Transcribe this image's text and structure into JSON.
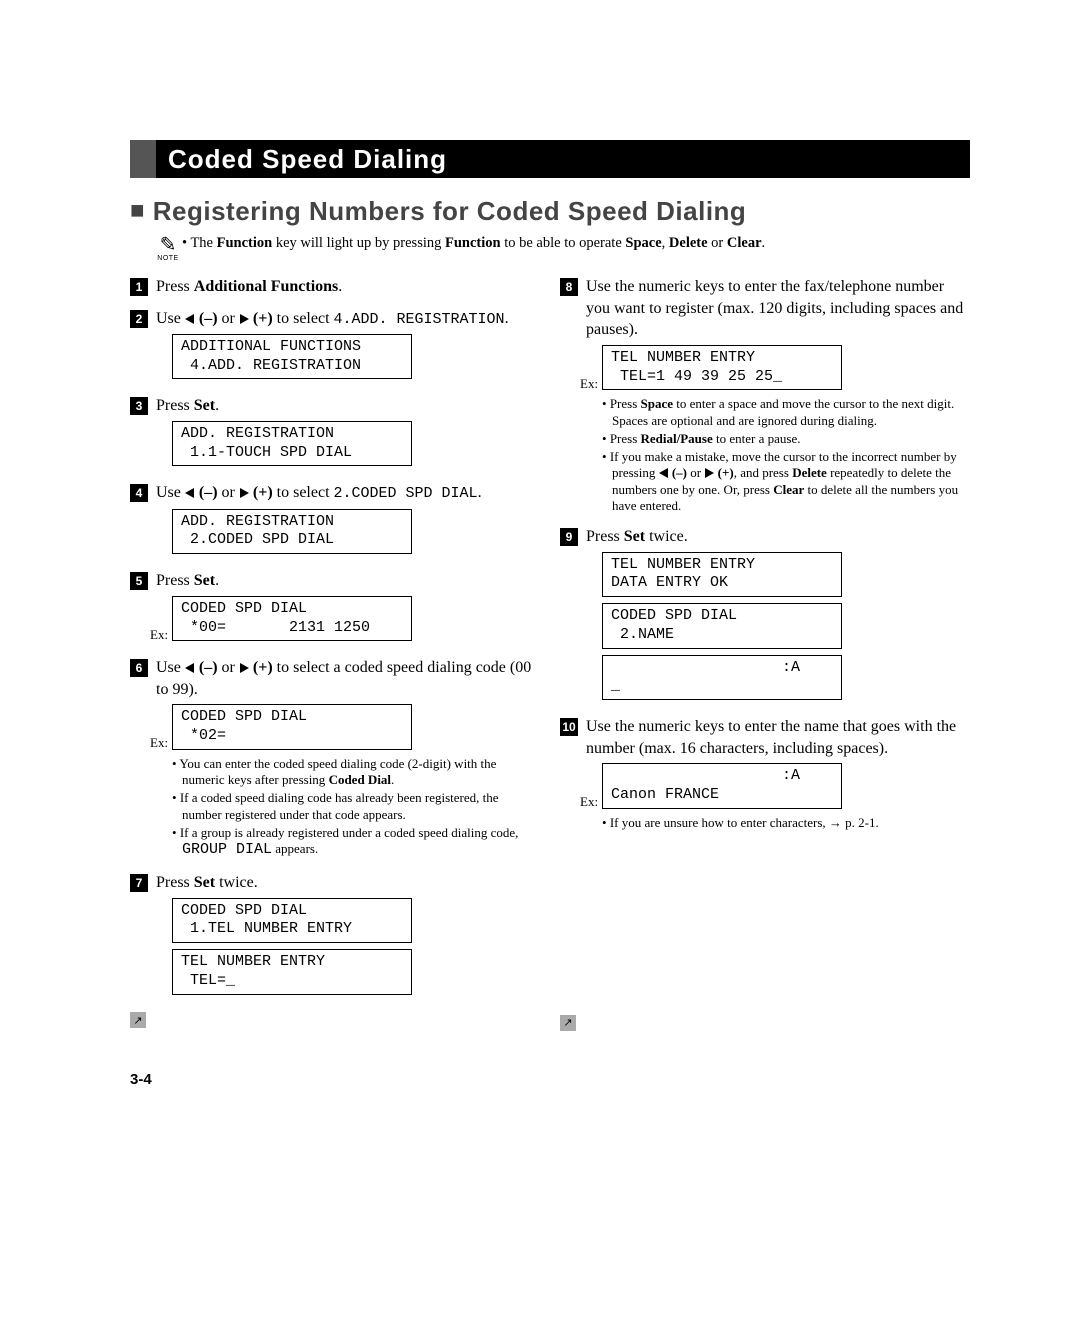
{
  "title": "Coded Speed Dialing",
  "section": "Registering Numbers for Coded Speed Dialing",
  "note_icon_label": "NOTE",
  "note_text_pre": "• The ",
  "note_bold1": "Function",
  "note_mid1": " key will light up by pressing ",
  "note_bold2": "Function",
  "note_mid2": " to be able to operate ",
  "note_bold3": "Space",
  "note_mid3": ", ",
  "note_bold4": "Delete",
  "note_mid4": " or ",
  "note_bold5": "Clear",
  "note_end": ".",
  "left": {
    "s1_pre": "Press ",
    "s1_b": "Additional Functions",
    "s1_post": ".",
    "s2_pre": "Use ",
    "s2_minus": " (–)",
    "s2_or": " or ",
    "s2_plus": " (+)",
    "s2_mid": " to select ",
    "s2_mono": "4.ADD. REGISTRATION",
    "s2_post": ".",
    "lcd2": "ADDITIONAL FUNCTIONS\n 4.ADD. REGISTRATION",
    "s3_pre": "Press ",
    "s3_b": "Set",
    "s3_post": ".",
    "lcd3": "ADD. REGISTRATION\n 1.1-TOUCH SPD DIAL",
    "s4_pre": "Use ",
    "s4_mid": " to select ",
    "s4_mono": "2.CODED SPD DIAL",
    "s4_post": ".",
    "lcd4": "ADD. REGISTRATION\n 2.CODED SPD DIAL",
    "s5_pre": "Press ",
    "s5_b": "Set",
    "s5_post": ".",
    "ex": "Ex:",
    "lcd5": "CODED SPD DIAL\n *00=       2131 1250",
    "s6_pre": "Use ",
    "s6_mid": " to select a coded speed dialing code (00 to 99).",
    "lcd6": "CODED SPD DIAL\n *02=",
    "s6b1a": "You can enter the coded speed dialing code (2-digit) with the numeric keys after pressing ",
    "s6b1b": "Coded Dial",
    "s6b1c": ".",
    "s6b2": "If a coded speed dialing code has already been registered, the number registered under that code appears.",
    "s6b3a": "If a group is already registered under a coded speed dialing code, ",
    "s6b3mono": "GROUP DIAL",
    "s6b3b": " appears.",
    "s7_pre": "Press ",
    "s7_b": "Set",
    "s7_post": " twice.",
    "lcd7a": "CODED SPD DIAL\n 1.TEL NUMBER ENTRY",
    "lcd7b": "TEL NUMBER ENTRY\n TEL=_"
  },
  "right": {
    "s8": "Use the numeric keys to enter the fax/telephone number you want to register (max. 120 digits, including spaces and pauses).",
    "lcd8": "TEL NUMBER ENTRY\n TEL=1 49 39 25 25_",
    "s8b1a": "Press ",
    "s8b1b": "Space",
    "s8b1c": " to enter a space and move the cursor to the next digit. Spaces are optional and are ignored during dialing.",
    "s8b2a": "Press ",
    "s8b2b": "Redial/Pause",
    "s8b2c": " to enter a pause.",
    "s8b3a": "If you make a mistake, move the cursor to the incorrect number by pressing ",
    "s8b3mid": ", and press ",
    "s8b3b": "Delete",
    "s8b3c": " repeatedly to delete the numbers one by one. Or, press ",
    "s8b3d": "Clear",
    "s8b3e": " to delete all the numbers you have entered.",
    "s9_pre": "Press ",
    "s9_b": "Set",
    "s9_post": " twice.",
    "lcd9a": "TEL NUMBER ENTRY\nDATA ENTRY OK",
    "lcd9b": "CODED SPD DIAL\n 2.NAME",
    "lcd9c": "                   :A\n_",
    "s10": "Use the numeric keys to enter the name that goes with the number (max. 16 characters, including spaces).",
    "lcd10": "                   :A\nCanon FRANCE",
    "s10b1": "If you are unsure how to enter characters, → p. 2-1."
  },
  "page_num": "3-4"
}
